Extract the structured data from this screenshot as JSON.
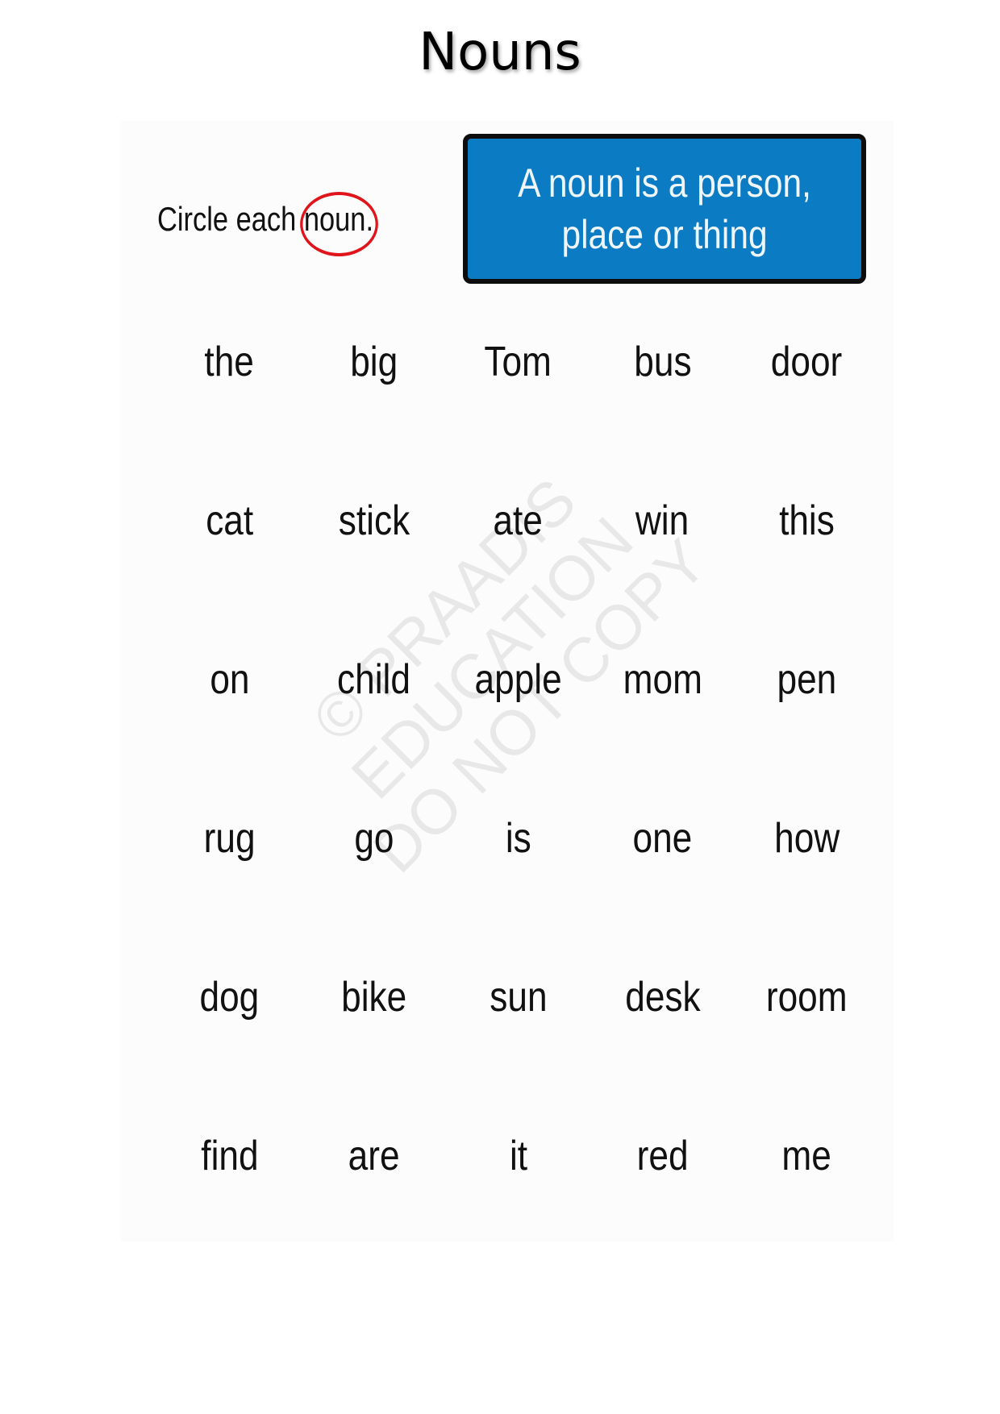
{
  "page": {
    "title": "Nouns"
  },
  "worksheet": {
    "instruction": {
      "prefix": "Circle each ",
      "circled_word": "noun."
    },
    "definition": {
      "line1": "A noun is a person,",
      "line2": "place or thing"
    },
    "watermark": {
      "line1": "© PRAADIS",
      "line2": "EDUCATION",
      "line3": "DO NOT COPY"
    },
    "colors": {
      "definition_box": "#0b7bc4",
      "circle_mark": "#e0151b"
    },
    "words": [
      [
        "the",
        "big",
        "Tom",
        "bus",
        "door"
      ],
      [
        "cat",
        "stick",
        "ate",
        "win",
        "this"
      ],
      [
        "on",
        "child",
        "apple",
        "mom",
        "pen"
      ],
      [
        "rug",
        "go",
        "is",
        "one",
        "how"
      ],
      [
        "dog",
        "bike",
        "sun",
        "desk",
        "room"
      ],
      [
        "find",
        "are",
        "it",
        "red",
        "me"
      ]
    ]
  }
}
